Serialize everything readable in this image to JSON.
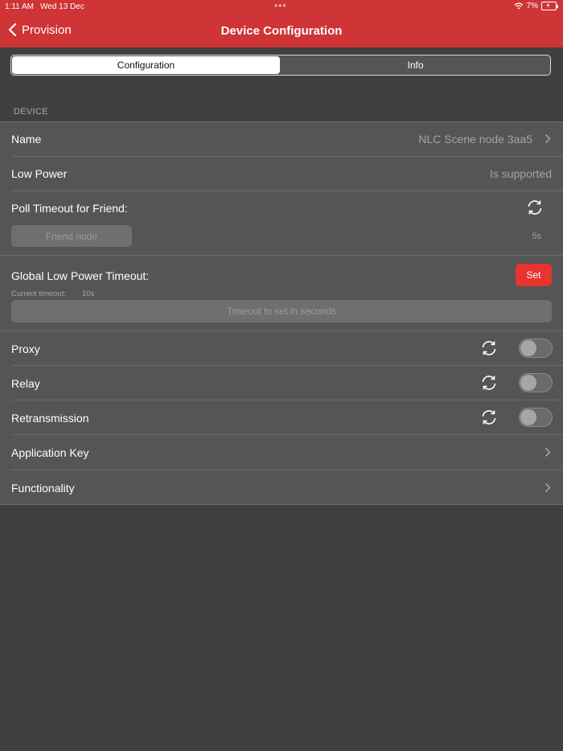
{
  "status_bar": {
    "time": "1:11 AM",
    "date": "Wed 13 Dec",
    "battery": "7%"
  },
  "nav": {
    "back_label": "Provision",
    "title": "Device Configuration"
  },
  "segments": {
    "configuration": "Configuration",
    "info": "Info"
  },
  "section": {
    "label": "DEVICE"
  },
  "rows": {
    "name": {
      "label": "Name",
      "value": "NLC Scene node 3aa5"
    },
    "low_power": {
      "label": "Low Power",
      "value": "Is supported"
    },
    "poll_timeout": {
      "label": "Poll Timeout for Friend:",
      "button": "Friend node",
      "value": "5s"
    },
    "global_timeout": {
      "label": "Global Low Power Timeout:",
      "set_label": "Set",
      "current_label": "Current timeout:",
      "current_value": "10s",
      "placeholder": "Timeout to set in seconds"
    },
    "proxy": {
      "label": "Proxy",
      "enabled": false
    },
    "relay": {
      "label": "Relay",
      "enabled": false
    },
    "retransmission": {
      "label": "Retransmission",
      "enabled": false
    },
    "app_key": {
      "label": "Application Key"
    },
    "functionality": {
      "label": "Functionality"
    }
  },
  "colors": {
    "header": "#cf3437",
    "accent_button": "#e8332e",
    "background": "#404040",
    "cell": "#555555"
  }
}
